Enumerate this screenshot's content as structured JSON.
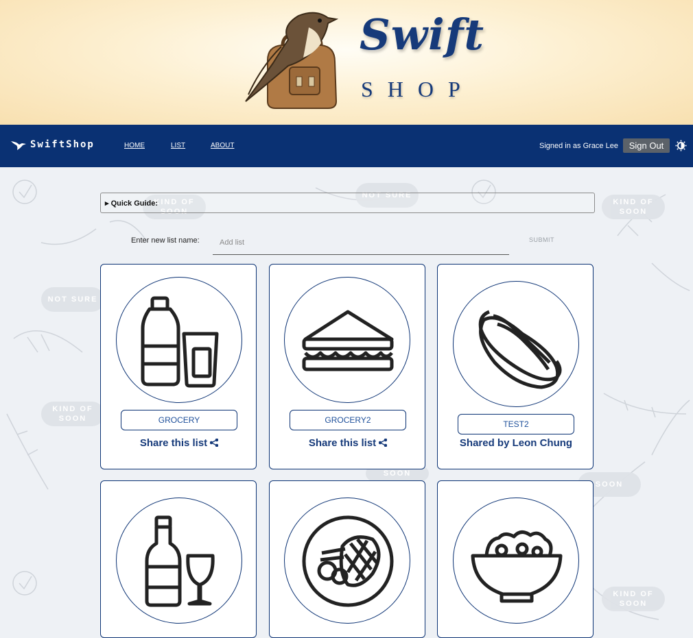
{
  "hero": {
    "title": "Swift",
    "subtitle": "SHOP"
  },
  "nav": {
    "brand": "SwiftShop",
    "links": [
      {
        "label": "HOME"
      },
      {
        "label": "LIST"
      },
      {
        "label": "ABOUT"
      }
    ],
    "signed_in": "Signed in as Grace Lee",
    "signout_label": "Sign Out"
  },
  "decor_pills": [
    "KIND OF SOON",
    "NOT SURE",
    "KIND OF SOON",
    "NOT SURE",
    "KIND OF SOON",
    "SOON",
    "SOON",
    "KIND OF SOON"
  ],
  "guide": {
    "label": "Quick Guide:"
  },
  "new_list": {
    "label": "Enter new list name:",
    "placeholder": "Add list",
    "value": "",
    "submit_label": "SUBMIT"
  },
  "cards": [
    {
      "icon": "bottle-and-glass-icon",
      "name": "GROCERY",
      "footer": "Share this list",
      "shared": false
    },
    {
      "icon": "sandwich-icon",
      "name": "GROCERY2",
      "footer": "Share this list",
      "shared": false
    },
    {
      "icon": "hotdog-icon",
      "name": "TEST2",
      "footer": "Shared by Leon Chung",
      "shared": true
    },
    {
      "icon": "wine-icon",
      "name": "",
      "footer": "",
      "shared": false
    },
    {
      "icon": "meal-plate-icon",
      "name": "",
      "footer": "",
      "shared": false
    },
    {
      "icon": "salad-bowl-icon",
      "name": "",
      "footer": "",
      "shared": false
    }
  ],
  "colors": {
    "primary": "#0a3173",
    "hero_bg": "#fdf0d2",
    "accent_text": "#163a7a"
  }
}
